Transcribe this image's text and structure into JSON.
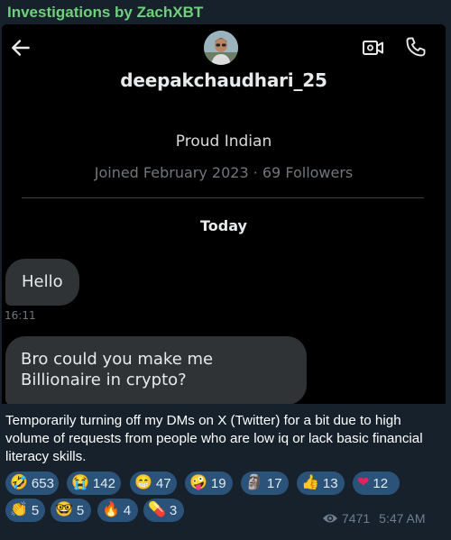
{
  "channel": {
    "name": "Investigations by ZachXBT"
  },
  "dm": {
    "username": "deepakchaudhari_25",
    "bio": "Proud Indian",
    "meta": "Joined February 2023 · 69 Followers",
    "date_separator": "Today",
    "messages": [
      {
        "text": "Hello",
        "time": "16:11"
      },
      {
        "text": "Bro could you make me Billionaire in crypto?"
      }
    ],
    "icons": [
      "back-arrow-icon",
      "video-call-icon",
      "phone-call-icon"
    ]
  },
  "post": {
    "text": "Temporarily turning off my DMs on X (Twitter) for a bit due to high volume of requests from people who are low iq or lack basic financial literacy skills.",
    "reactions": [
      {
        "emoji": "🤣",
        "count": "653"
      },
      {
        "emoji": "😭",
        "count": "142"
      },
      {
        "emoji": "😁",
        "count": "47"
      },
      {
        "emoji": "🤪",
        "count": "19"
      },
      {
        "emoji": "🗿",
        "count": "17"
      },
      {
        "emoji": "👍",
        "count": "13"
      },
      {
        "emoji": "❤",
        "count": "12"
      },
      {
        "emoji": "👏",
        "count": "5"
      },
      {
        "emoji": "🤓",
        "count": "5"
      },
      {
        "emoji": "🔥",
        "count": "4"
      },
      {
        "emoji": "💊",
        "count": "3"
      }
    ],
    "views": "7471",
    "time": "5:47 AM"
  },
  "colors": {
    "channel_name": "#6fd07b",
    "reaction_pill": "#2b5278",
    "bubble": "#2f3336",
    "background": "#17212b"
  }
}
